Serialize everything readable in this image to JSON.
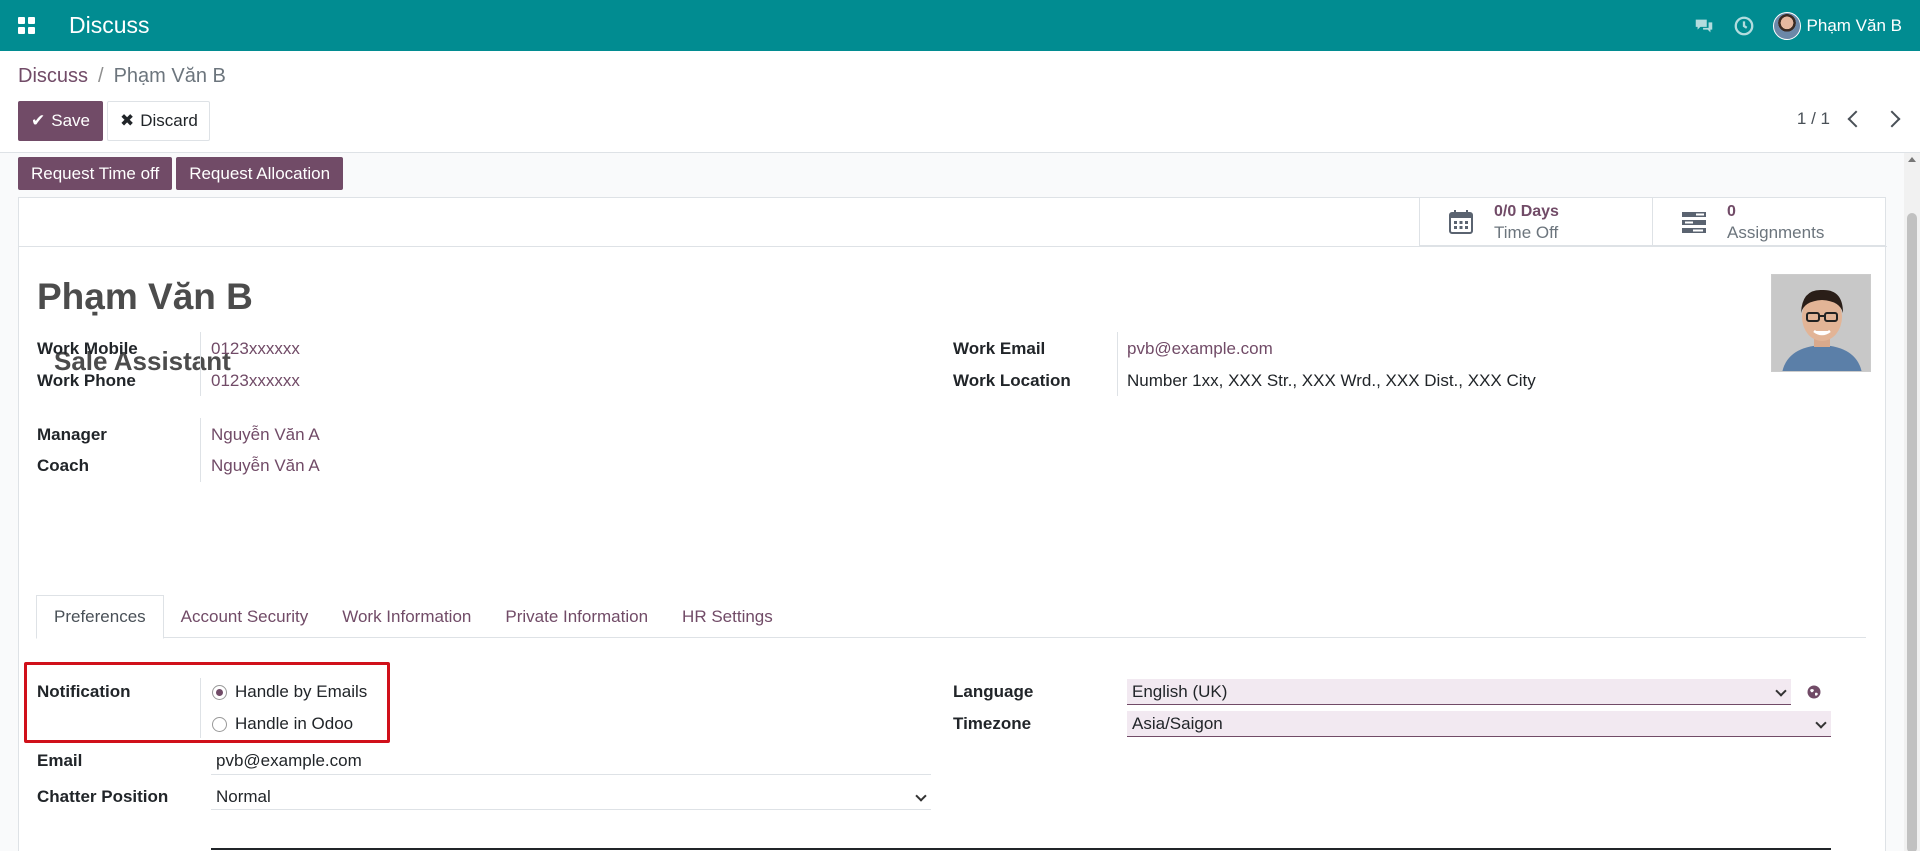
{
  "topbar": {
    "app_title": "Discuss",
    "user_name": "Phạm Văn B"
  },
  "breadcrumb": {
    "parent": "Discuss",
    "separator": "/",
    "current": "Phạm Văn B"
  },
  "toolbar": {
    "save_label": "Save",
    "discard_label": "Discard"
  },
  "pager": {
    "value": "1 / 1"
  },
  "actions": {
    "request_time_off": "Request Time off",
    "request_allocation": "Request Allocation"
  },
  "stats": {
    "time_off": {
      "value": "0/0 Days",
      "label": "Time Off"
    },
    "assignments": {
      "value": "0",
      "label": "Assignments"
    }
  },
  "employee": {
    "name": "Phạm Văn B",
    "job_title": "Sale Assistant"
  },
  "fields": {
    "work_mobile": {
      "label": "Work Mobile",
      "value": "0123xxxxxx"
    },
    "work_phone": {
      "label": "Work Phone",
      "value": "0123xxxxxx"
    },
    "manager": {
      "label": "Manager",
      "value": "Nguyễn Văn A"
    },
    "coach": {
      "label": "Coach",
      "value": "Nguyễn Văn A"
    },
    "work_email": {
      "label": "Work Email",
      "value": "pvb@example.com"
    },
    "work_location": {
      "label": "Work Location",
      "value": "Number 1xx, XXX Str., XXX Wrd., XXX Dist., XXX City"
    }
  },
  "tabs": [
    {
      "label": "Preferences",
      "active": true
    },
    {
      "label": "Account Security",
      "active": false
    },
    {
      "label": "Work Information",
      "active": false
    },
    {
      "label": "Private Information",
      "active": false
    },
    {
      "label": "HR Settings",
      "active": false
    }
  ],
  "preferences": {
    "notification_label": "Notification",
    "notification_options": [
      {
        "label": "Handle by Emails",
        "checked": true
      },
      {
        "label": "Handle in Odoo",
        "checked": false
      }
    ],
    "email_label": "Email",
    "email_value": "pvb@example.com",
    "chatter_label": "Chatter Position",
    "chatter_value": "Normal",
    "language_label": "Language",
    "language_value": "English (UK)",
    "timezone_label": "Timezone",
    "timezone_value": "Asia/Saigon"
  },
  "colors": {
    "topbar": "#018c91",
    "accent": "#714b67",
    "highlight": "#d0101a"
  }
}
